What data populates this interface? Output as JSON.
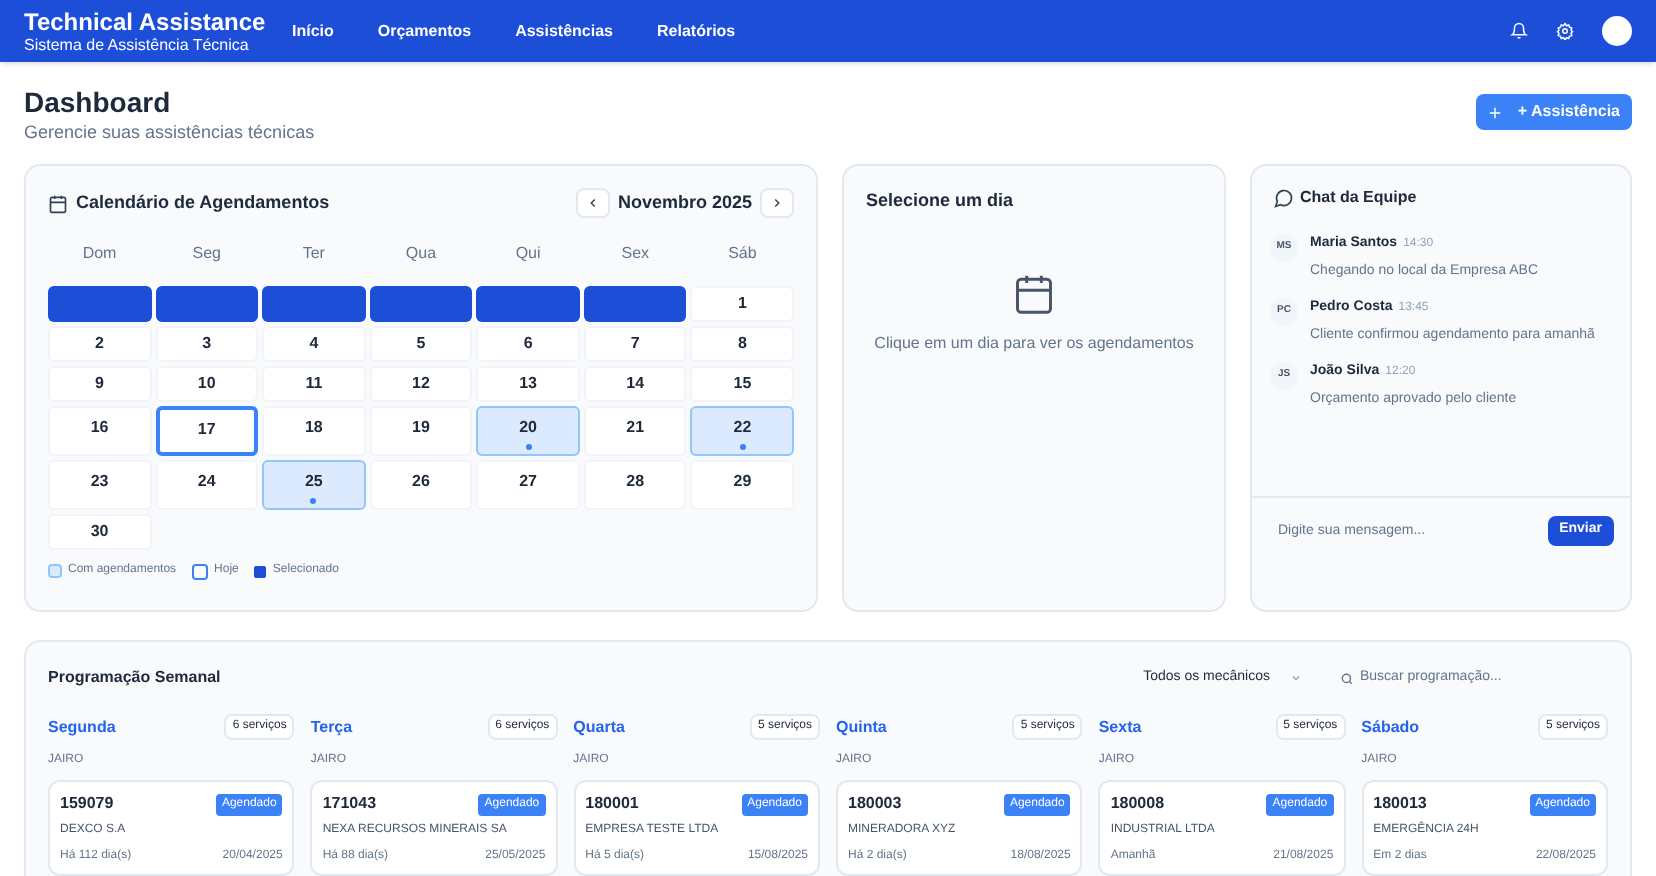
{
  "header": {
    "title": "Technical Assistance",
    "subtitle": "Sistema de Assistência Técnica",
    "nav": [
      {
        "label": "Início"
      },
      {
        "label": "Orçamentos"
      },
      {
        "label": "Assistências"
      },
      {
        "label": "Relatórios"
      }
    ]
  },
  "page": {
    "title": "Dashboard",
    "subtitle": "Gerencie suas assistências técnicas",
    "new_button": "+ Assistência"
  },
  "calendar": {
    "title": "Calendário de Agendamentos",
    "month": "Novembro 2025",
    "weekdays": [
      "Dom",
      "Seg",
      "Ter",
      "Qua",
      "Qui",
      "Sex",
      "Sáb"
    ],
    "cells": [
      {
        "kind": "blank"
      },
      {
        "kind": "blank"
      },
      {
        "kind": "blank"
      },
      {
        "kind": "blank"
      },
      {
        "kind": "blank"
      },
      {
        "kind": "blank"
      },
      {
        "kind": "day",
        "label": "1",
        "today": false,
        "scheduled": false
      },
      {
        "kind": "day",
        "label": "2",
        "today": false,
        "scheduled": false
      },
      {
        "kind": "day",
        "label": "3",
        "today": false,
        "scheduled": false
      },
      {
        "kind": "day",
        "label": "4",
        "today": false,
        "scheduled": false
      },
      {
        "kind": "day",
        "label": "5",
        "today": false,
        "scheduled": false
      },
      {
        "kind": "day",
        "label": "6",
        "today": false,
        "scheduled": false
      },
      {
        "kind": "day",
        "label": "7",
        "today": false,
        "scheduled": false
      },
      {
        "kind": "day",
        "label": "8",
        "today": false,
        "scheduled": false
      },
      {
        "kind": "day",
        "label": "9",
        "today": false,
        "scheduled": false
      },
      {
        "kind": "day",
        "label": "10",
        "today": false,
        "scheduled": false
      },
      {
        "kind": "day",
        "label": "11",
        "today": false,
        "scheduled": false
      },
      {
        "kind": "day",
        "label": "12",
        "today": false,
        "scheduled": false
      },
      {
        "kind": "day",
        "label": "13",
        "today": false,
        "scheduled": false
      },
      {
        "kind": "day",
        "label": "14",
        "today": false,
        "scheduled": false
      },
      {
        "kind": "day",
        "label": "15",
        "today": false,
        "scheduled": false
      },
      {
        "kind": "day",
        "label": "16",
        "today": false,
        "scheduled": false
      },
      {
        "kind": "day",
        "label": "17",
        "today": true,
        "scheduled": false
      },
      {
        "kind": "day",
        "label": "18",
        "today": false,
        "scheduled": false
      },
      {
        "kind": "day",
        "label": "19",
        "today": false,
        "scheduled": false
      },
      {
        "kind": "day",
        "label": "20",
        "today": false,
        "scheduled": true
      },
      {
        "kind": "day",
        "label": "21",
        "today": false,
        "scheduled": false
      },
      {
        "kind": "day",
        "label": "22",
        "today": false,
        "scheduled": true
      },
      {
        "kind": "day",
        "label": "23",
        "today": false,
        "scheduled": false
      },
      {
        "kind": "day",
        "label": "24",
        "today": false,
        "scheduled": false
      },
      {
        "kind": "day",
        "label": "25",
        "today": false,
        "scheduled": true
      },
      {
        "kind": "day",
        "label": "26",
        "today": false,
        "scheduled": false
      },
      {
        "kind": "day",
        "label": "27",
        "today": false,
        "scheduled": false
      },
      {
        "kind": "day",
        "label": "28",
        "today": false,
        "scheduled": false
      },
      {
        "kind": "day",
        "label": "29",
        "today": false,
        "scheduled": false
      },
      {
        "kind": "day",
        "label": "30",
        "today": false,
        "scheduled": false
      }
    ],
    "legend": [
      {
        "kind": "scheduled",
        "label": "Com agendamentos"
      },
      {
        "kind": "today",
        "label": "Hoje"
      },
      {
        "kind": "selected",
        "label": "Selecionado"
      }
    ]
  },
  "day_panel": {
    "title": "Selecione um dia",
    "message": "Clique em um dia para ver os agendamentos"
  },
  "chat": {
    "title": "Chat da Equipe",
    "messages": [
      {
        "initials": "MS",
        "author": "Maria Santos",
        "time": "14:30",
        "text": "Chegando no local da Empresa ABC"
      },
      {
        "initials": "PC",
        "author": "Pedro Costa",
        "time": "13:45",
        "text": "Cliente confirmou agendamento para amanhã"
      },
      {
        "initials": "JS",
        "author": "João Silva",
        "time": "12:20",
        "text": "Orçamento aprovado pelo cliente"
      }
    ],
    "input_placeholder": "Digite sua mensagem...",
    "send_button": "Enviar"
  },
  "weekly": {
    "title": "Programação Semanal",
    "mechanic_filter": "Todos os mecânicos",
    "search_placeholder": "Buscar programação...",
    "days": [
      {
        "name": "Segunda",
        "count": "6 serviços",
        "mechanic": "JAIRO",
        "code": "159079",
        "status": "Agendado",
        "client": "DEXCO S.A",
        "age": "Há 112 dia(s)",
        "date": "20/04/2025"
      },
      {
        "name": "Terça",
        "count": "6 serviços",
        "mechanic": "JAIRO",
        "code": "171043",
        "status": "Agendado",
        "client": "NEXA RECURSOS MINERAIS SA",
        "age": "Há 88 dia(s)",
        "date": "25/05/2025"
      },
      {
        "name": "Quarta",
        "count": "5 serviços",
        "mechanic": "JAIRO",
        "code": "180001",
        "status": "Agendado",
        "client": "EMPRESA TESTE LTDA",
        "age": "Há 5 dia(s)",
        "date": "15/08/2025"
      },
      {
        "name": "Quinta",
        "count": "5 serviços",
        "mechanic": "JAIRO",
        "code": "180003",
        "status": "Agendado",
        "client": "MINERADORA XYZ",
        "age": "Há 2 dia(s)",
        "date": "18/08/2025"
      },
      {
        "name": "Sexta",
        "count": "5 serviços",
        "mechanic": "JAIRO",
        "code": "180008",
        "status": "Agendado",
        "client": "INDUSTRIAL LTDA",
        "age": "Amanhã",
        "date": "21/08/2025"
      },
      {
        "name": "Sábado",
        "count": "5 serviços",
        "mechanic": "JAIRO",
        "code": "180013",
        "status": "Agendado",
        "client": "EMERGÊNCIA 24H",
        "age": "Em 2 dias",
        "date": "22/08/2025"
      }
    ]
  }
}
